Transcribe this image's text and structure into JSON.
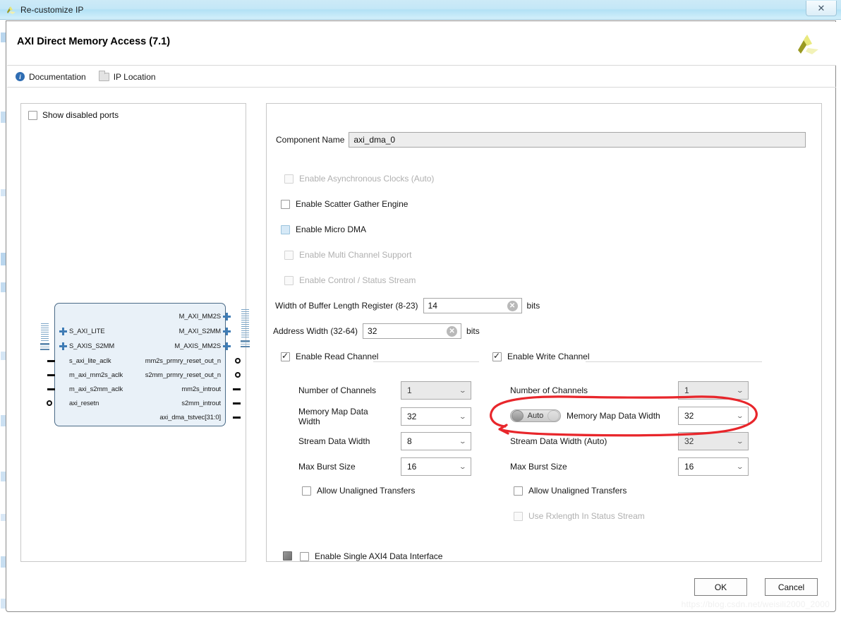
{
  "window": {
    "title": "Re-customize IP",
    "close_label": "✕",
    "app_icon": "xilinx-logo-icon"
  },
  "header": {
    "title": "AXI Direct Memory Access (7.1)",
    "logo": "xilinx-logo-icon"
  },
  "toolbar": {
    "documentation": "Documentation",
    "ip_location": "IP Location",
    "doc_icon": "info-icon",
    "loc_icon": "folder-icon"
  },
  "left_panel": {
    "show_disabled_ports": "Show disabled ports",
    "show_disabled_checked": false,
    "block": {
      "left_bus_ports": [
        "S_AXI_LITE",
        "S_AXIS_S2MM"
      ],
      "left_signal_ports": [
        "s_axi_lite_aclk",
        "m_axi_mm2s_aclk",
        "m_axi_s2mm_aclk",
        "axi_resetn"
      ],
      "right_bus_ports": [
        "M_AXI_MM2S",
        "M_AXI_S2MM",
        "M_AXIS_MM2S"
      ],
      "right_signal_ports": [
        "mm2s_prmry_reset_out_n",
        "s2mm_prmry_reset_out_n",
        "mm2s_introut",
        "s2mm_introut",
        "axi_dma_tstvec[31:0]"
      ]
    }
  },
  "main": {
    "component_name_label": "Component Name",
    "component_name_value": "axi_dma_0",
    "options": [
      {
        "label": "Enable Asynchronous Clocks (Auto)",
        "checked": false,
        "disabled": true,
        "hover": false
      },
      {
        "label": "Enable Scatter Gather Engine",
        "checked": false,
        "disabled": false,
        "hover": false
      },
      {
        "label": "Enable Micro DMA",
        "checked": false,
        "disabled": false,
        "hover": true
      },
      {
        "label": "Enable Multi Channel Support",
        "checked": false,
        "disabled": true,
        "hover": false
      },
      {
        "label": "Enable Control / Status Stream",
        "checked": false,
        "disabled": true,
        "hover": false
      }
    ],
    "buffer_length": {
      "label": "Width of Buffer Length Register (8-23)",
      "value": "14",
      "unit": "bits",
      "clear_icon": "clear-x-icon"
    },
    "address_width": {
      "label": "Address Width (32-64)",
      "value": "32",
      "unit": "bits",
      "clear_icon": "clear-x-icon"
    },
    "read_channel": {
      "enable_label": "Enable Read Channel",
      "enabled": true,
      "fields": [
        {
          "label": "Number of Channels",
          "value": "1",
          "disabled": true
        },
        {
          "label": "Memory Map Data Width",
          "value": "32",
          "disabled": false
        },
        {
          "label": "Stream Data Width",
          "value": "8",
          "disabled": false
        },
        {
          "label": "Max Burst Size",
          "value": "16",
          "disabled": false
        }
      ],
      "allow_unaligned_label": "Allow Unaligned Transfers",
      "allow_unaligned_checked": false
    },
    "write_channel": {
      "enable_label": "Enable Write Channel",
      "enabled": true,
      "auto_toggle_label": "Auto",
      "fields": [
        {
          "label": "Number of Channels",
          "value": "1",
          "disabled": true
        },
        {
          "label": "Memory Map Data Width",
          "value": "32",
          "disabled": false
        },
        {
          "label": "Stream Data Width (Auto)",
          "value": "32",
          "disabled": true
        },
        {
          "label": "Max Burst Size",
          "value": "16",
          "disabled": false
        }
      ],
      "allow_unaligned_label": "Allow Unaligned Transfers",
      "allow_unaligned_checked": false,
      "use_rxlength_label": "Use Rxlength In Status Stream",
      "use_rxlength_checked": false,
      "use_rxlength_disabled": true
    },
    "single_axi4": {
      "label": "Enable Single AXI4 Data Interface",
      "checked": false
    }
  },
  "footer": {
    "ok": "OK",
    "cancel": "Cancel"
  },
  "watermark": "https://blog.csdn.net/weisili2000_2000",
  "annotation": {
    "type": "hand-drawn-red-ellipse",
    "color": "#e8262b",
    "target": "Stream Data Width (Auto)"
  }
}
